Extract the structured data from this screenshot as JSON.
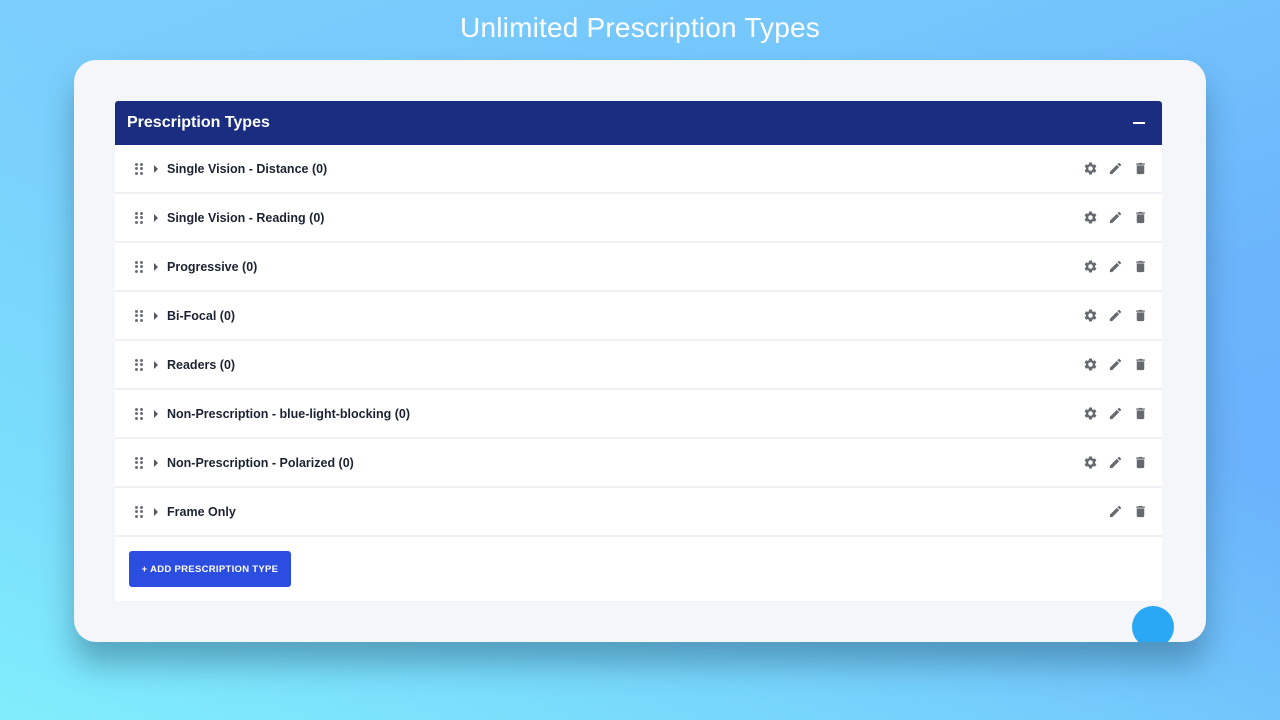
{
  "hero": {
    "title": "Unlimited Prescription Types"
  },
  "panel": {
    "title": "Prescription Types",
    "collapse_icon": "minus-icon",
    "rows": [
      {
        "label": "Single Vision - Distance (0)",
        "actions": [
          "gear-icon",
          "pencil-icon",
          "trash-icon"
        ]
      },
      {
        "label": "Single Vision - Reading (0)",
        "actions": [
          "gear-icon",
          "pencil-icon",
          "trash-icon"
        ]
      },
      {
        "label": "Progressive (0)",
        "actions": [
          "gear-icon",
          "pencil-icon",
          "trash-icon"
        ]
      },
      {
        "label": "Bi-Focal (0)",
        "actions": [
          "gear-icon",
          "pencil-icon",
          "trash-icon"
        ]
      },
      {
        "label": "Readers (0)",
        "actions": [
          "gear-icon",
          "pencil-icon",
          "trash-icon"
        ]
      },
      {
        "label": "Non-Prescription - blue-light-blocking (0)",
        "actions": [
          "gear-icon",
          "pencil-icon",
          "trash-icon"
        ]
      },
      {
        "label": "Non-Prescription - Polarized (0)",
        "actions": [
          "gear-icon",
          "pencil-icon",
          "trash-icon"
        ]
      },
      {
        "label": "Frame Only",
        "actions": [
          "pencil-icon",
          "trash-icon"
        ]
      }
    ],
    "add_button_label": "+ ADD PRESCRIPTION TYPE"
  },
  "colors": {
    "header_bg": "#1a2d80",
    "button_bg": "#2c4ee0",
    "fab": "#2aa8f5",
    "icon": "#666a70"
  }
}
